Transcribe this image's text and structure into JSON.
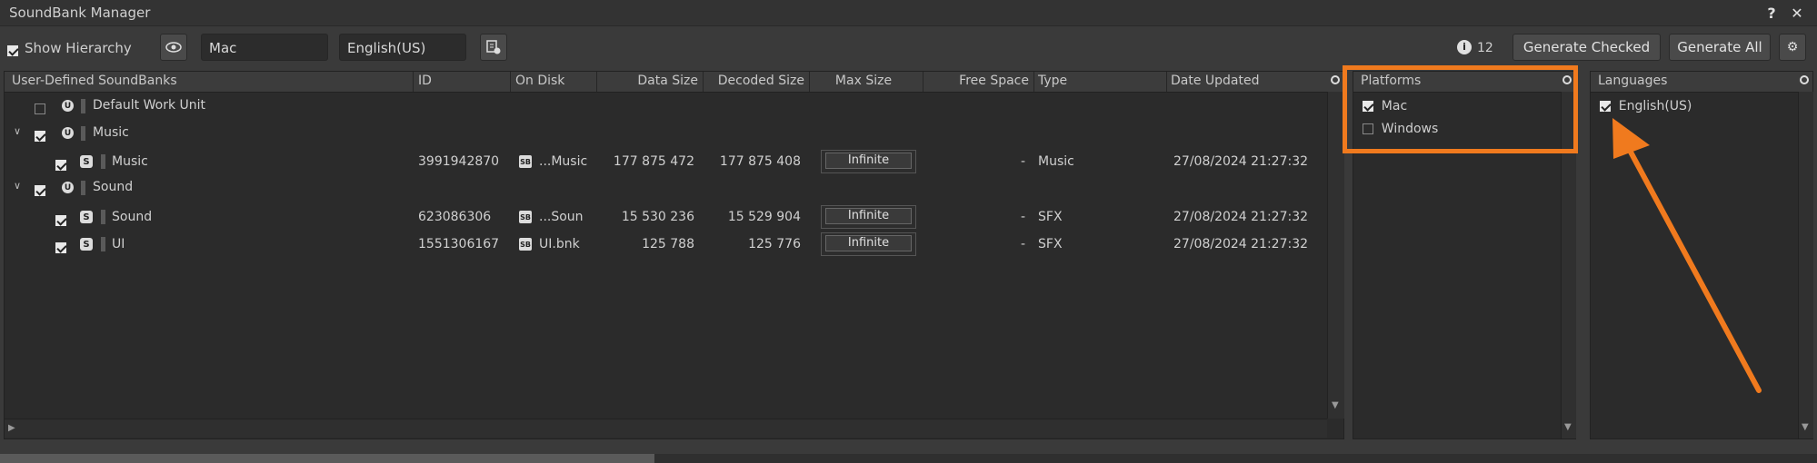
{
  "window": {
    "title": "SoundBank Manager"
  },
  "toolbar": {
    "show_hierarchy_label": "Show Hierarchy",
    "platform_value": "Mac",
    "language_value": "English(US)",
    "info_count": "12",
    "generate_checked_label": "Generate Checked",
    "generate_all_label": "Generate All"
  },
  "table": {
    "headers": [
      "User-Defined SoundBanks",
      "ID",
      "On Disk",
      "Data Size",
      "Decoded Size",
      "Max Size",
      "Free Space",
      "Type",
      "Date Updated"
    ],
    "rows": [
      {
        "name": "Default Work Unit",
        "id": "",
        "disk": "",
        "data": "",
        "decoded": "",
        "max": "",
        "free": "",
        "type": "",
        "date": ""
      },
      {
        "name": "Music",
        "id": "",
        "disk": "",
        "data": "",
        "decoded": "",
        "max": "",
        "free": "",
        "type": "",
        "date": ""
      },
      {
        "name": "Music",
        "id": "3991942870",
        "disk": "...Music",
        "data": "177 875 472",
        "decoded": "177 875 408",
        "max": "Infinite",
        "free": "-",
        "type": "Music",
        "date": "27/08/2024 21:27:32"
      },
      {
        "name": "Sound",
        "id": "",
        "disk": "",
        "data": "",
        "decoded": "",
        "max": "",
        "free": "",
        "type": "",
        "date": ""
      },
      {
        "name": "Sound",
        "id": "623086306",
        "disk": "...Soun",
        "data": "15 530 236",
        "decoded": "15 529 904",
        "max": "Infinite",
        "free": "-",
        "type": "SFX",
        "date": "27/08/2024 21:27:32"
      },
      {
        "name": "UI",
        "id": "1551306167",
        "disk": "UI.bnk",
        "data": "125 788",
        "decoded": "125 776",
        "max": "Infinite",
        "free": "-",
        "type": "SFX",
        "date": "27/08/2024 21:27:32"
      }
    ]
  },
  "platforms": {
    "header": "Platforms",
    "items": [
      "Mac",
      "Windows"
    ]
  },
  "languages": {
    "header": "Languages",
    "items": [
      "English(US)"
    ]
  },
  "colors": {
    "highlight": "#f07a1e",
    "background": "#3a3a3a",
    "panel": "#2b2b2b"
  }
}
